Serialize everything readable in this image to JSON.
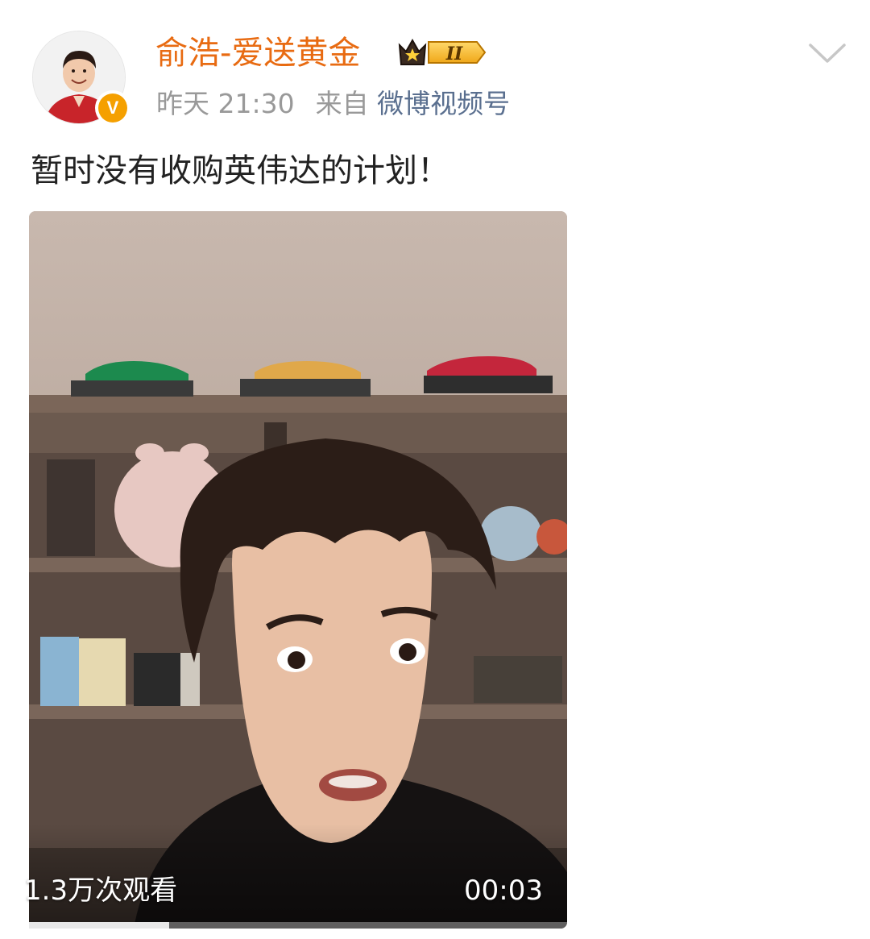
{
  "post": {
    "username": "俞浩-爱送黄金",
    "vip_level": "II",
    "time": "昨天 21:30",
    "source_prefix": "来自",
    "source": "微博视频号",
    "verify_mark": "V",
    "text": "暂时没有收购英伟达的计划！"
  },
  "video": {
    "views": "1.3万次观看",
    "duration": "00:03",
    "progress": 0.26
  },
  "icons": {
    "more": "chevron-down-icon",
    "verified": "verified-v-icon",
    "vip": "crown-vip-icon"
  },
  "colors": {
    "username": "#e86b12",
    "source_link": "#5a6f8f",
    "meta": "#999999",
    "verified": "#f5a000"
  }
}
